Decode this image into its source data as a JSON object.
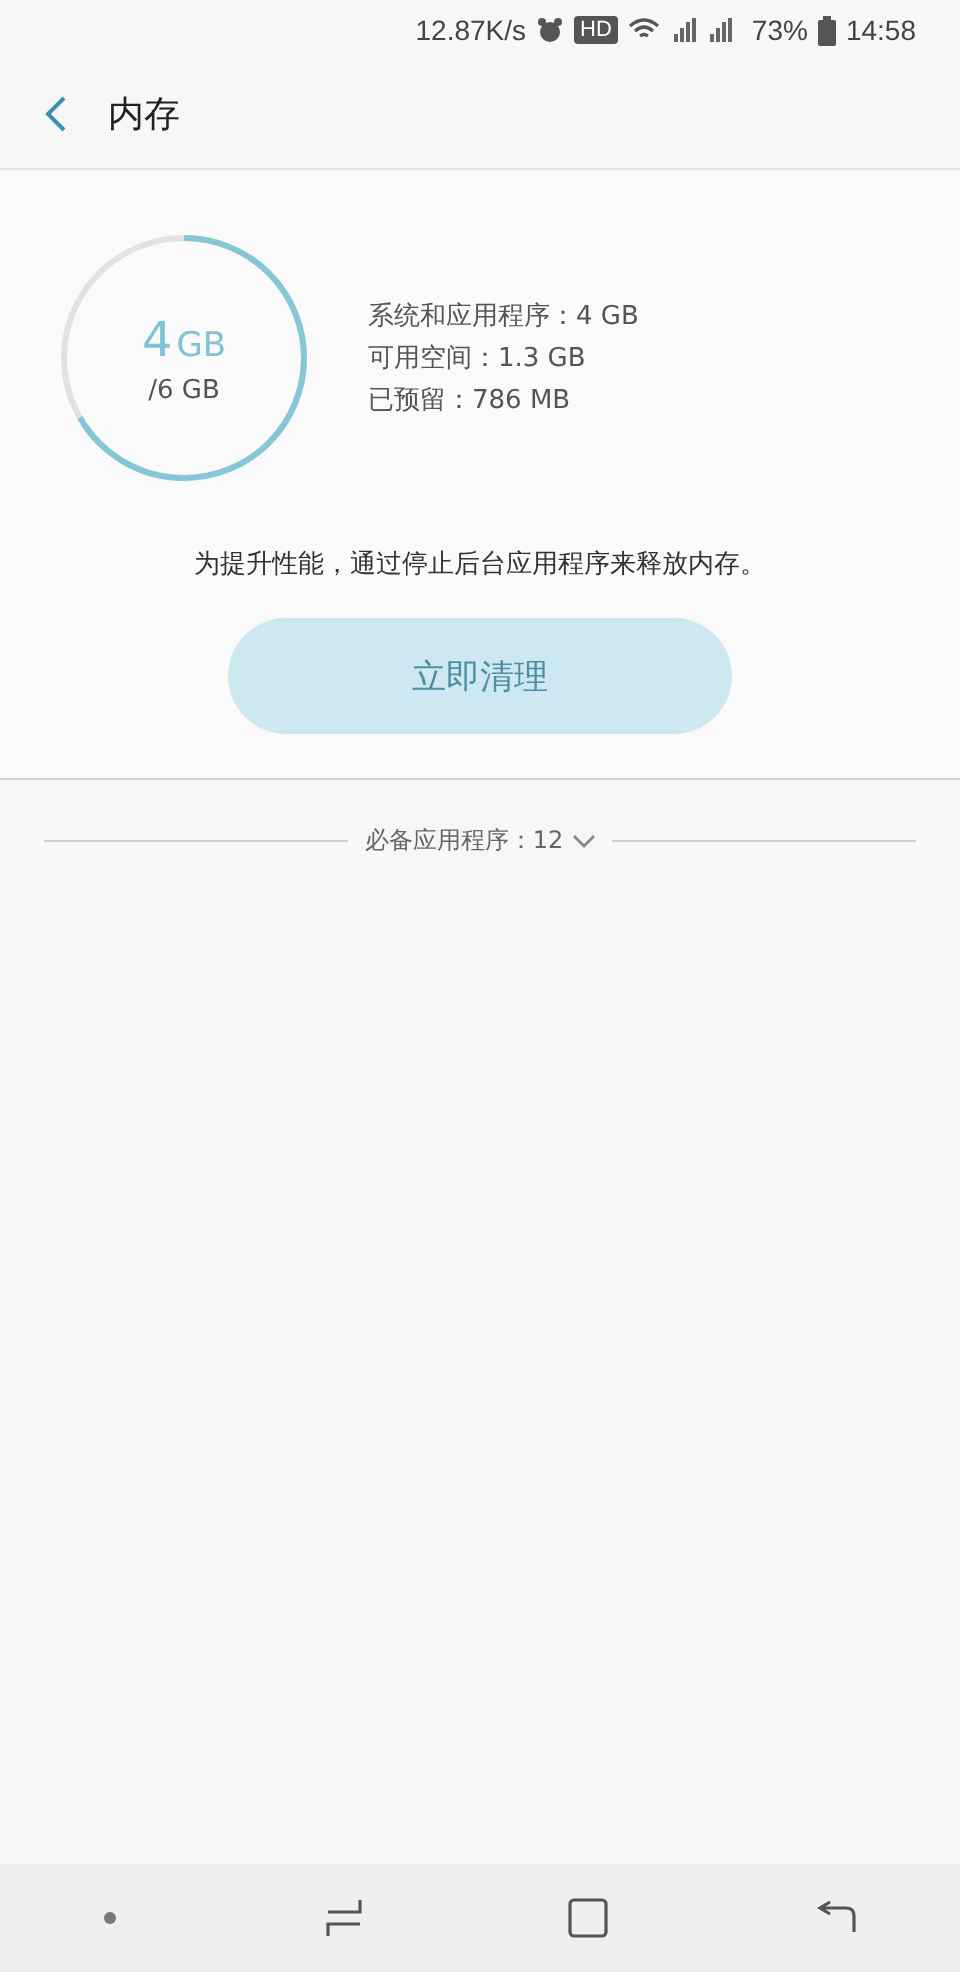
{
  "status_bar": {
    "speed": "12.87K/s",
    "hd": "HD",
    "battery": "73%",
    "time": "14:58"
  },
  "header": {
    "title": "内存"
  },
  "memory": {
    "used": "4",
    "used_unit": "GB",
    "total": "/6 GB",
    "level": 0.667,
    "stats": [
      "系统和应用程序：4 GB",
      "可用空间：1.3 GB",
      "已预留：786 MB"
    ],
    "hint": "为提升性能，通过停止后台应用程序来释放内存。",
    "button": {
      "label": "立即清理",
      "disabled": true
    }
  },
  "apps_section": {
    "label": "必备应用程序：12",
    "expanded": false
  }
}
